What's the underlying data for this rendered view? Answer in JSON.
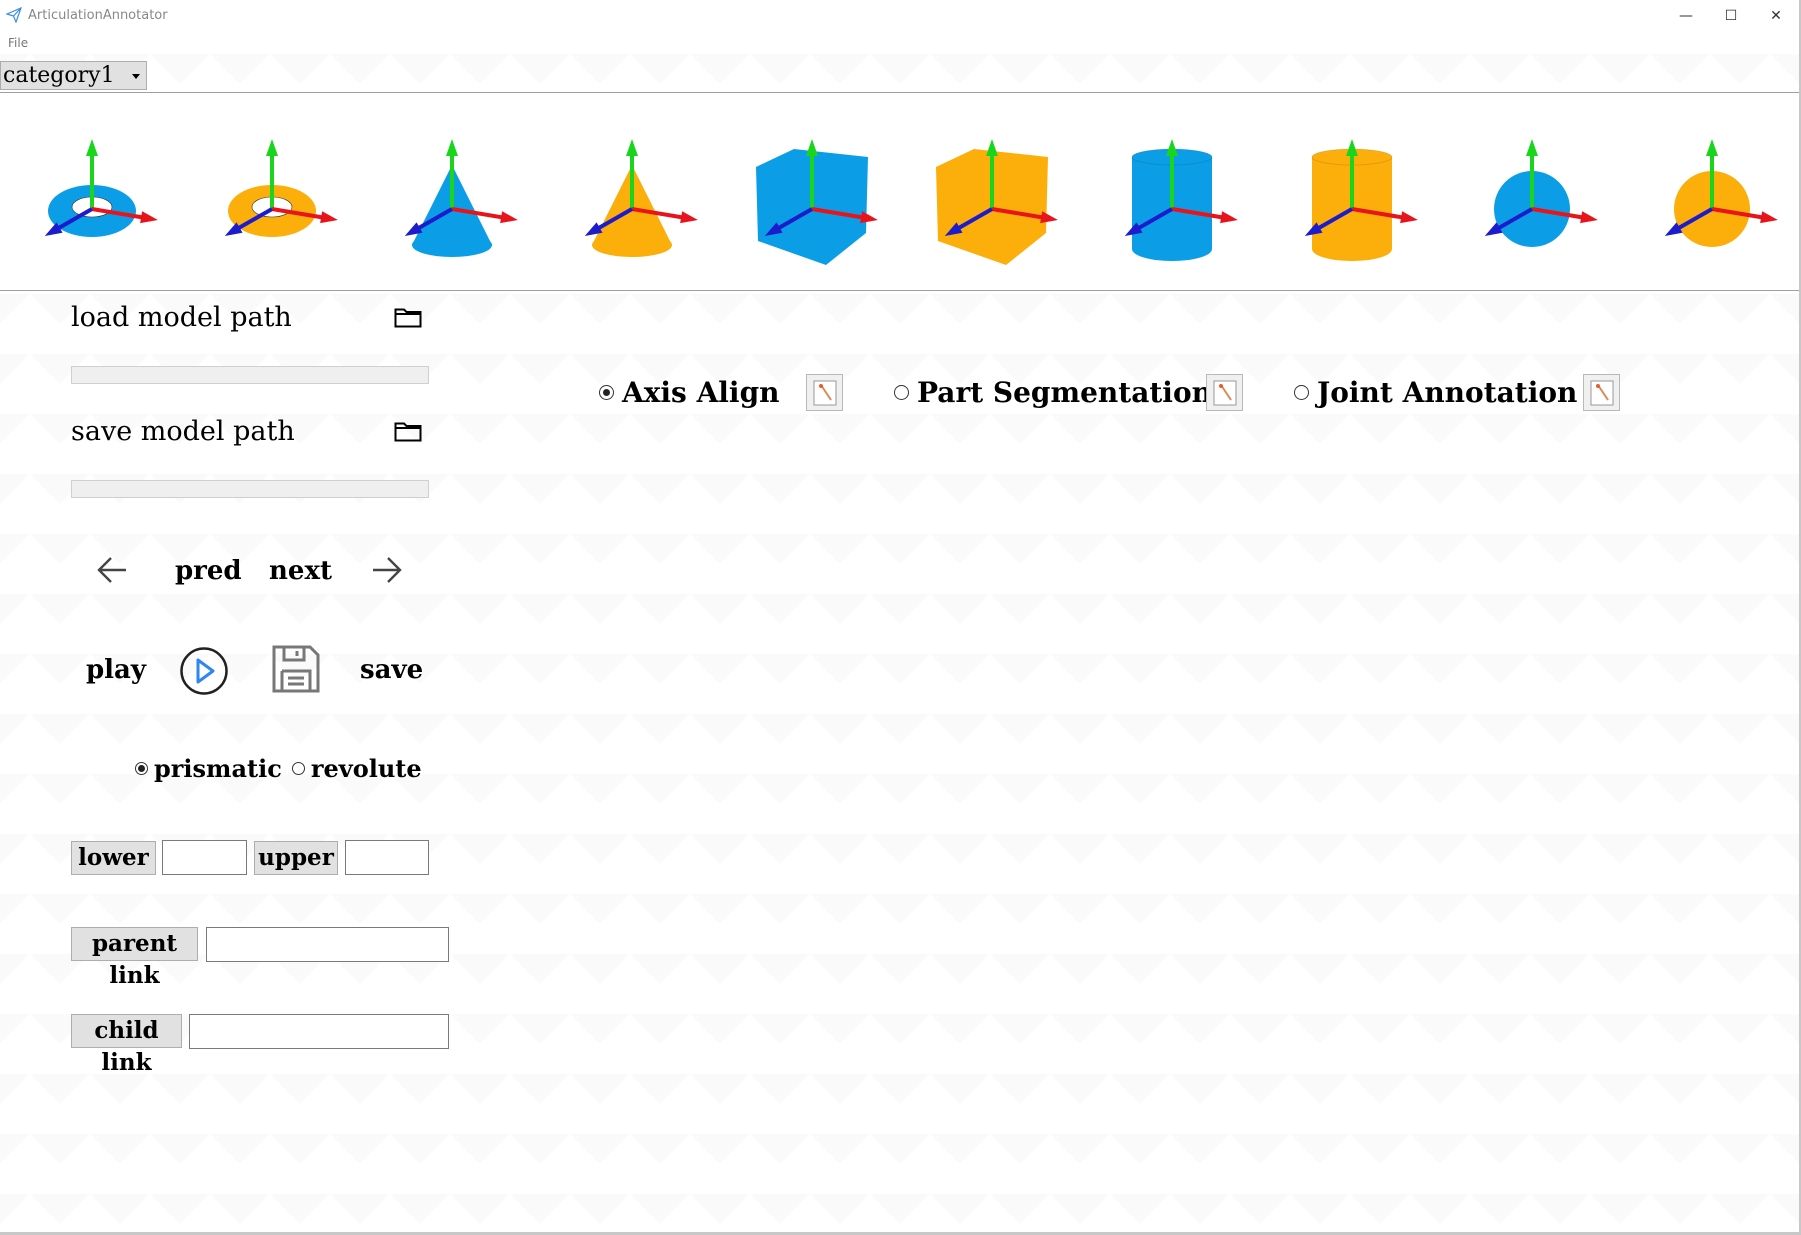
{
  "window": {
    "title": "ArticulationAnnotator",
    "minimize": "—",
    "maximize": "☐",
    "close": "✕"
  },
  "menu": {
    "file": "File"
  },
  "category": {
    "selected": "category1"
  },
  "thumbnails": [
    {
      "shape": "torus",
      "color": "#0b9ee6"
    },
    {
      "shape": "torus",
      "color": "#fcae0a"
    },
    {
      "shape": "cone",
      "color": "#0b9ee6"
    },
    {
      "shape": "cone",
      "color": "#fcae0a"
    },
    {
      "shape": "cube",
      "color": "#0b9ee6"
    },
    {
      "shape": "cube",
      "color": "#fcae0a"
    },
    {
      "shape": "cylinder",
      "color": "#0b9ee6"
    },
    {
      "shape": "cylinder",
      "color": "#fcae0a"
    },
    {
      "shape": "sphere",
      "color": "#0b9ee6"
    },
    {
      "shape": "sphere",
      "color": "#fcae0a"
    }
  ],
  "axis_colors": {
    "x": "#e8141c",
    "y": "#19d61c",
    "z": "#1c1ccc"
  },
  "paths": {
    "load_label": "load model path",
    "save_label": "save model path",
    "load_value": "",
    "save_value": ""
  },
  "nav": {
    "pred": "pred",
    "next": "next"
  },
  "actions": {
    "play": "play",
    "save": "save"
  },
  "joint_type": {
    "prismatic": "prismatic",
    "revolute": "revolute",
    "selected": "prismatic"
  },
  "limits": {
    "lower_label": "lower",
    "upper_label": "upper",
    "lower_value": "",
    "upper_value": ""
  },
  "links": {
    "parent_label": "parent link",
    "child_label": "child link",
    "parent_value": "",
    "child_value": ""
  },
  "modes": {
    "axis_align": "Axis Align",
    "part_segmentation": "Part Segmentation",
    "joint_annotation": "Joint Annotation",
    "selected": "axis_align"
  }
}
